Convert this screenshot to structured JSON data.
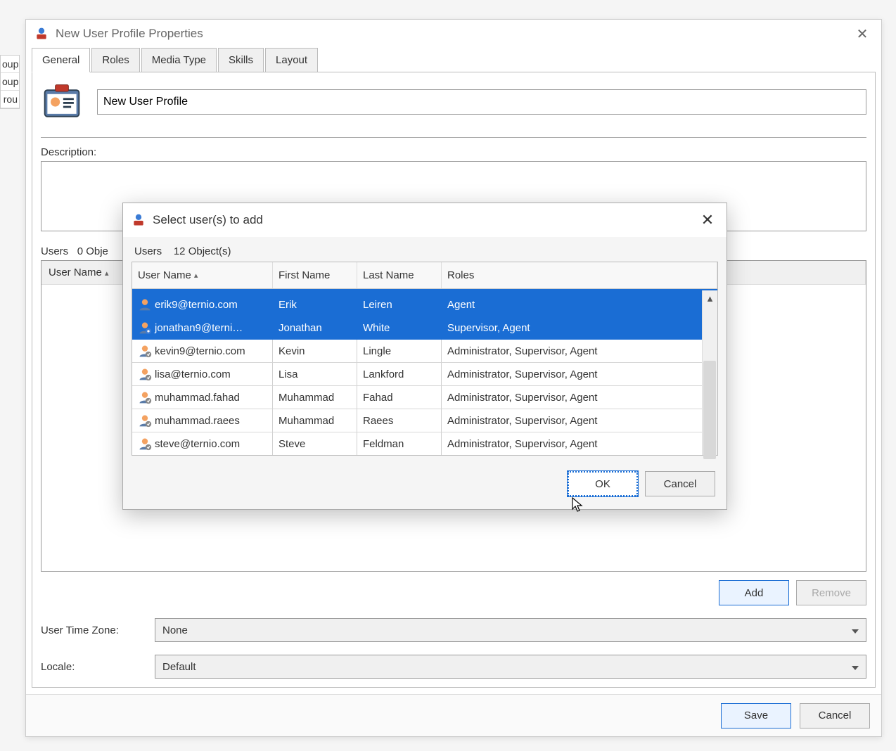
{
  "background_rows": [
    "oup",
    "oup",
    "rou"
  ],
  "parent": {
    "title": "New User Profile Properties",
    "tabs": [
      "General",
      "Roles",
      "Media Type",
      "Skills",
      "Layout"
    ],
    "active_tab": 0,
    "profile_name": "New User Profile",
    "description_label": "Description:",
    "users_label": "Users",
    "users_count_text": "0 Obje",
    "inner_header": "User Name",
    "buttons": {
      "add": "Add",
      "remove": "Remove"
    },
    "timezone_label": "User Time Zone:",
    "timezone_value": "None",
    "locale_label": "Locale:",
    "locale_value": "Default",
    "footer": {
      "save": "Save",
      "cancel": "Cancel"
    }
  },
  "modal": {
    "title": "Select user(s) to add",
    "list_label": "Users",
    "object_count": "12 Object(s)",
    "columns": [
      "User Name",
      "First Name",
      "Last Name",
      "Roles"
    ],
    "sort_indicator": "▴",
    "rows": [
      {
        "username": "erik9@ternio.com",
        "first": "Erik",
        "last": "Leiren",
        "roles": "Agent",
        "selected": true,
        "icon": "user"
      },
      {
        "username": "jonathan9@terni…",
        "first": "Jonathan",
        "last": "White",
        "roles": "Supervisor, Agent",
        "selected": true,
        "icon": "supervisor"
      },
      {
        "username": "kevin9@ternio.com",
        "first": "Kevin",
        "last": "Lingle",
        "roles": "Administrator, Supervisor, Agent",
        "selected": false,
        "icon": "admin"
      },
      {
        "username": "lisa@ternio.com",
        "first": "Lisa",
        "last": "Lankford",
        "roles": "Administrator, Supervisor, Agent",
        "selected": false,
        "icon": "admin"
      },
      {
        "username": "muhammad.fahad",
        "first": "Muhammad",
        "last": "Fahad",
        "roles": "Administrator, Supervisor, Agent",
        "selected": false,
        "icon": "admin"
      },
      {
        "username": "muhammad.raees",
        "first": "Muhammad",
        "last": "Raees",
        "roles": "Administrator, Supervisor, Agent",
        "selected": false,
        "icon": "admin"
      },
      {
        "username": "steve@ternio.com",
        "first": "Steve",
        "last": "Feldman",
        "roles": "Administrator, Supervisor, Agent",
        "selected": false,
        "icon": "admin"
      }
    ],
    "buttons": {
      "ok": "OK",
      "cancel": "Cancel"
    }
  }
}
